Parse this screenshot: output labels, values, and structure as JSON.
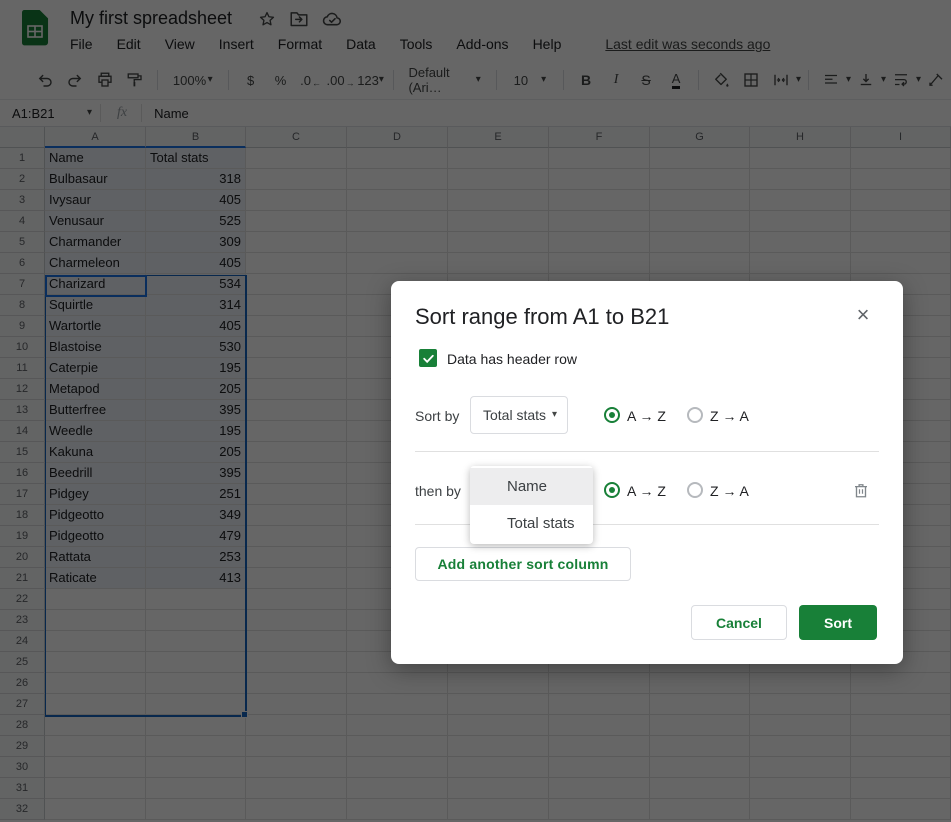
{
  "header": {
    "title": "My first spreadsheet",
    "menu": [
      "File",
      "Edit",
      "View",
      "Insert",
      "Format",
      "Data",
      "Tools",
      "Add-ons",
      "Help"
    ],
    "last_edit": "Last edit was seconds ago"
  },
  "toolbar": {
    "zoom": "100%",
    "currency": "$",
    "percent": "%",
    "decimal_decrease": ".0",
    "decimal_increase": ".00",
    "more_formats": "123",
    "font_family": "Default (Ari…",
    "font_size": "10",
    "bold": "B",
    "italic": "I",
    "strikethrough": "S",
    "text_color": "A"
  },
  "formula_bar": {
    "name_box": "A1:B21",
    "fx_label": "fx",
    "input_value": "Name"
  },
  "sheet": {
    "columns": [
      "A",
      "B",
      "C",
      "D",
      "E",
      "F",
      "G",
      "H",
      "I"
    ],
    "row_count": 32,
    "selected_range": "A1:B21",
    "header_row": [
      "Name",
      "Total stats"
    ],
    "data": [
      [
        "Bulbasaur",
        "318"
      ],
      [
        "Ivysaur",
        "405"
      ],
      [
        "Venusaur",
        "525"
      ],
      [
        "Charmander",
        "309"
      ],
      [
        "Charmeleon",
        "405"
      ],
      [
        "Charizard",
        "534"
      ],
      [
        "Squirtle",
        "314"
      ],
      [
        "Wartortle",
        "405"
      ],
      [
        "Blastoise",
        "530"
      ],
      [
        "Caterpie",
        "195"
      ],
      [
        "Metapod",
        "205"
      ],
      [
        "Butterfree",
        "395"
      ],
      [
        "Weedle",
        "195"
      ],
      [
        "Kakuna",
        "205"
      ],
      [
        "Beedrill",
        "395"
      ],
      [
        "Pidgey",
        "251"
      ],
      [
        "Pidgeotto",
        "349"
      ],
      [
        "Pidgeotto",
        "479"
      ],
      [
        "Rattata",
        "253"
      ],
      [
        "Raticate",
        "413"
      ]
    ]
  },
  "dialog": {
    "title": "Sort range from A1 to B21",
    "header_checkbox_label": "Data has header row",
    "sort_by_label": "Sort by",
    "sort_by_value": "Total stats",
    "then_by_label": "then by",
    "asc_label": "A → Z",
    "desc_label": "Z → A",
    "add_button": "Add another sort column",
    "cancel_button": "Cancel",
    "sort_button": "Sort"
  },
  "dropdown": {
    "items": [
      "Name",
      "Total stats"
    ],
    "highlighted": "Name"
  },
  "icons": {
    "caret": "▾",
    "close": "×",
    "arrow_left": "←",
    "arrow_right": "→"
  },
  "colors": {
    "green": "#188038",
    "blue": "#1a73e8",
    "overlay": "rgba(0,0,0,0.6)"
  }
}
